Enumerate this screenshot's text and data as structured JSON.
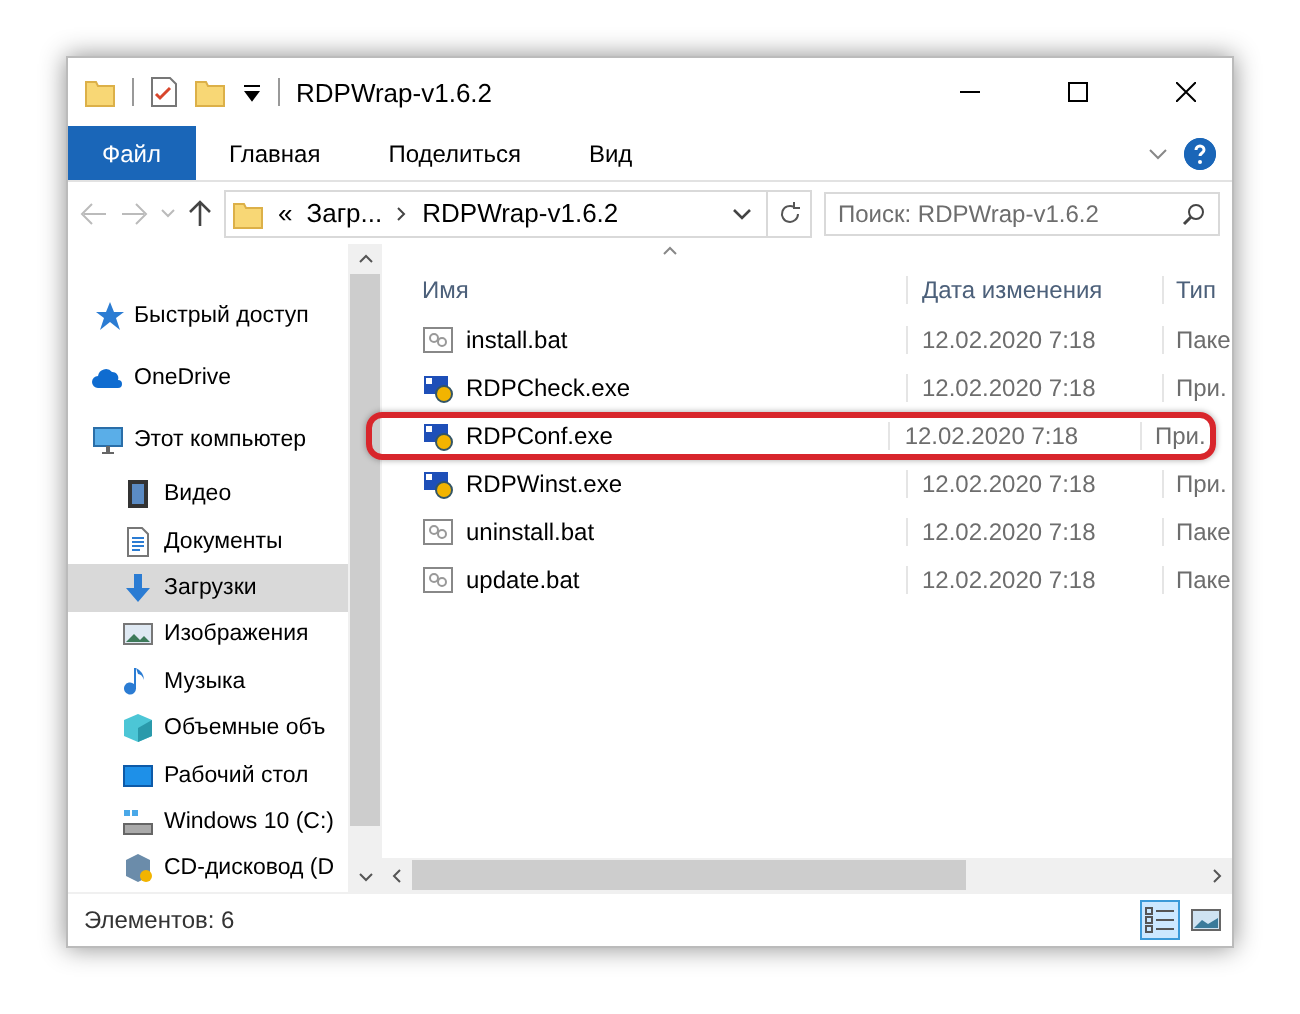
{
  "window": {
    "title": "RDPWrap-v1.6.2"
  },
  "ribbon_tabs": [
    {
      "label": "Файл",
      "selected": true
    },
    {
      "label": "Главная",
      "selected": false
    },
    {
      "label": "Поделиться",
      "selected": false
    },
    {
      "label": "Вид",
      "selected": false
    }
  ],
  "address": {
    "overflow": "«",
    "crumbs": [
      "Загр...",
      "RDPWrap-v1.6.2"
    ]
  },
  "search": {
    "placeholder": "Поиск: RDPWrap-v1.6.2"
  },
  "nav": [
    {
      "label": "Быстрый доступ",
      "kind": "star",
      "selected": false
    },
    {
      "label": "OneDrive",
      "kind": "cloud",
      "selected": false
    },
    {
      "label": "Этот компьютер",
      "kind": "computer",
      "selected": false,
      "children": [
        {
          "label": "Видео",
          "kind": "video",
          "selected": false
        },
        {
          "label": "Документы",
          "kind": "document",
          "selected": false
        },
        {
          "label": "Загрузки",
          "kind": "download",
          "selected": true
        },
        {
          "label": "Изображения",
          "kind": "image",
          "selected": false
        },
        {
          "label": "Музыка",
          "kind": "music",
          "selected": false
        },
        {
          "label": "Объемные объ",
          "kind": "cube",
          "selected": false
        },
        {
          "label": "Рабочий стол",
          "kind": "desktop",
          "selected": false
        },
        {
          "label": "Windows 10 (C:)",
          "kind": "drive",
          "selected": false
        },
        {
          "label": "CD-дисковод (D",
          "kind": "cd",
          "selected": false
        }
      ]
    }
  ],
  "columns": [
    "Имя",
    "Дата изменения",
    "Тип"
  ],
  "files": [
    {
      "name": "install.bat",
      "date": "12.02.2020 7:18",
      "type": "Паке",
      "kind": "bat",
      "highlighted": false
    },
    {
      "name": "RDPCheck.exe",
      "date": "12.02.2020 7:18",
      "type": "При.",
      "kind": "exe",
      "highlighted": false
    },
    {
      "name": "RDPConf.exe",
      "date": "12.02.2020 7:18",
      "type": "При.",
      "kind": "exe",
      "highlighted": true
    },
    {
      "name": "RDPWinst.exe",
      "date": "12.02.2020 7:18",
      "type": "При.",
      "kind": "exe",
      "highlighted": false
    },
    {
      "name": "uninstall.bat",
      "date": "12.02.2020 7:18",
      "type": "Паке",
      "kind": "bat",
      "highlighted": false
    },
    {
      "name": "update.bat",
      "date": "12.02.2020 7:18",
      "type": "Паке",
      "kind": "bat",
      "highlighted": false
    }
  ],
  "status_bar": {
    "count": "Элементов: 6"
  },
  "view_buttons": [
    {
      "kind": "details",
      "selected": true
    },
    {
      "kind": "tiles",
      "selected": false
    }
  ]
}
